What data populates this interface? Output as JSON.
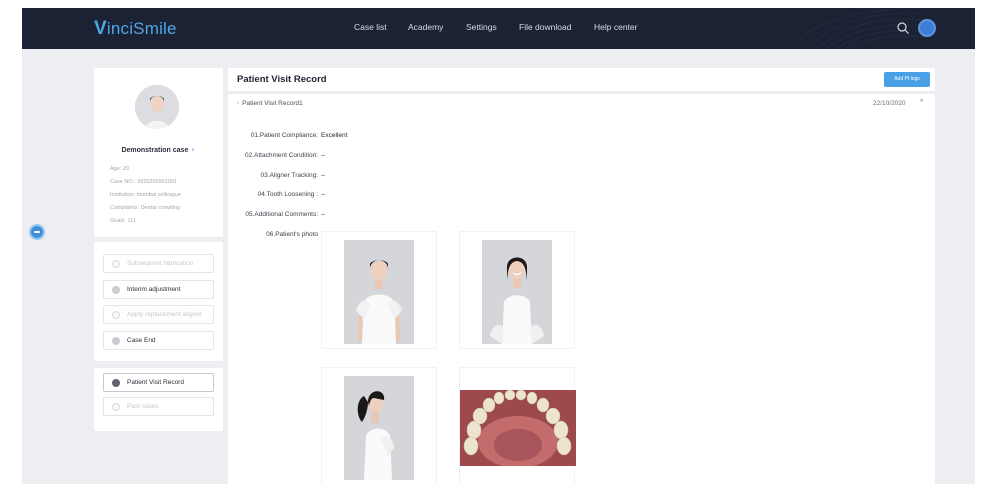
{
  "brand": {
    "logo_initial": "V",
    "logo_rest": "inciSmile"
  },
  "nav": [
    "Case list",
    "Academy",
    "Settings",
    "File download",
    "Help center"
  ],
  "profile": {
    "name": "Demonstration case",
    "age": "Age: 20",
    "case_no": "Case NO.: 9920200901001",
    "institution": "Institution: mumbai colleague",
    "complaints": "Complaints: Dental crowding",
    "goals": "Goals: 111"
  },
  "actions": [
    {
      "label": "Subsequent fabrication",
      "enabled": false
    },
    {
      "label": "Interim adjustment",
      "enabled": true
    },
    {
      "label": "Apply replacement aligner",
      "enabled": false
    },
    {
      "label": "Case End",
      "enabled": true
    }
  ],
  "records_nav": [
    {
      "label": "Patient Visit Record",
      "active": true
    },
    {
      "label": "Past cases",
      "active": false
    }
  ],
  "header": {
    "title": "Patient Visit Record",
    "add_button": "Add Pt logs"
  },
  "record": {
    "title": "Patient Visit Record1",
    "date": "22/10/2020",
    "fields": [
      {
        "label": "01.Patient Compliance:",
        "value": "Excellent"
      },
      {
        "label": "02.Attachment Condition:",
        "value": "--"
      },
      {
        "label": "03.Aligner Tracking:",
        "value": "--"
      },
      {
        "label": "04.Tooth Loosening :",
        "value": "--"
      },
      {
        "label": "05.Additional Comments:",
        "value": "--"
      }
    ],
    "photo_label": "06.Patient's photo"
  },
  "icons": {
    "search": "search-icon",
    "user_avatar": "user-avatar",
    "chat": "chat-icon",
    "expand": "chevron-right-icon",
    "collapse": "chevron-up-icon",
    "person": "person-icon"
  },
  "colors": {
    "topbar": "#1b2233",
    "brand": "#4fa6e6",
    "accent": "#4aa0e6",
    "background": "#eceef1"
  }
}
